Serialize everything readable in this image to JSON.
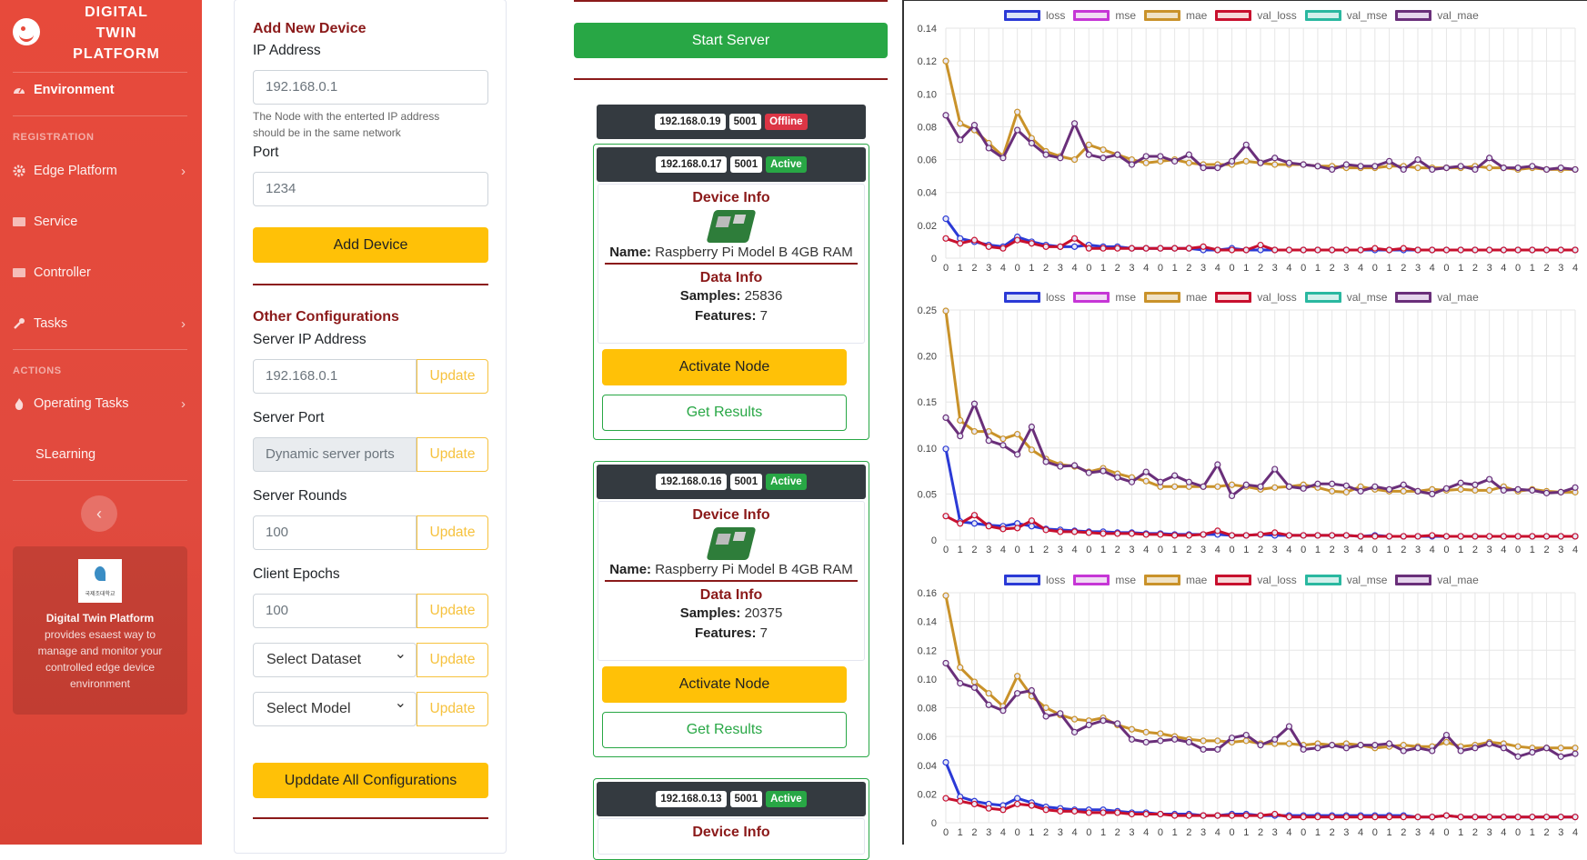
{
  "sidebar": {
    "brand": [
      "DIGITAL",
      "TWIN",
      "PLATFORM"
    ],
    "environment": "Environment",
    "registration_heading": "REGISTRATION",
    "edge_platform": "Edge Platform",
    "service": "Service",
    "controller": "Controller",
    "tasks": "Tasks",
    "actions_heading": "ACTIONS",
    "operating_tasks": "Operating Tasks",
    "slearning": "SLearning",
    "card_title": "Digital Twin Platform",
    "card_text": "provides esaest way to manage and monitor your controlled edge device environment",
    "logo_text": "국제조대학교"
  },
  "add_device": {
    "title": "Add New Device",
    "ip_label": "IP Address",
    "ip_placeholder": "192.168.0.1",
    "ip_help": "The Node with the enterted IP address should be in the same network",
    "port_label": "Port",
    "port_placeholder": "1234",
    "button": "Add Device"
  },
  "other_config": {
    "title": "Other Configurations",
    "server_ip_label": "Server IP Address",
    "server_ip_placeholder": "192.168.0.1",
    "server_port_label": "Server Port",
    "server_port_value": "Dynamic server ports",
    "server_rounds_label": "Server Rounds",
    "server_rounds_placeholder": "100",
    "client_epochs_label": "Client Epochs",
    "client_epochs_placeholder": "100",
    "dataset_select": "Select Dataset",
    "model_select": "Select Model",
    "update_label": "Update",
    "update_all": "Upddate All Configurations"
  },
  "server": {
    "start_button": "Start Server",
    "devices": [
      {
        "ip": "192.168.0.19",
        "port": "5001",
        "status": "Offline"
      },
      {
        "ip": "192.168.0.17",
        "port": "5001",
        "status": "Active",
        "device_info": "Device Info",
        "name_label": "Name:",
        "name": "Raspberry Pi Model B 4GB RAM",
        "data_info": "Data Info",
        "samples_label": "Samples:",
        "samples": "25836",
        "features_label": "Features:",
        "features": "7",
        "activate": "Activate Node",
        "results": "Get Results"
      },
      {
        "ip": "192.168.0.16",
        "port": "5001",
        "status": "Active",
        "device_info": "Device Info",
        "name_label": "Name:",
        "name": "Raspberry Pi Model B 4GB RAM",
        "data_info": "Data Info",
        "samples_label": "Samples:",
        "samples": "20375",
        "features_label": "Features:",
        "features": "7",
        "activate": "Activate Node",
        "results": "Get Results"
      },
      {
        "ip": "192.168.0.13",
        "port": "5001",
        "status": "Active",
        "device_info": "Device Info"
      }
    ]
  },
  "chart_data": [
    {
      "type": "line",
      "legend": [
        "loss",
        "mse",
        "mae",
        "val_loss",
        "val_mse",
        "val_mae"
      ],
      "x": [
        "0",
        "1",
        "2",
        "3",
        "4",
        "0",
        "1",
        "2",
        "3",
        "4",
        "0",
        "1",
        "2",
        "3",
        "4",
        "0",
        "1",
        "2",
        "3",
        "4",
        "0",
        "1",
        "2",
        "3",
        "4",
        "0",
        "1",
        "2",
        "3",
        "4",
        "0",
        "1",
        "2",
        "3",
        "4",
        "0",
        "1",
        "2",
        "3",
        "4",
        "0",
        "1",
        "2",
        "3",
        "4"
      ],
      "ylim": [
        0,
        0.14
      ],
      "yticks": [
        "0",
        "0.02",
        "0.04",
        "0.06",
        "0.08",
        "0.10",
        "0.12",
        "0.14"
      ],
      "series": [
        {
          "name": "loss",
          "values": [
            0.024,
            0.012,
            0.01,
            0.008,
            0.007,
            0.013,
            0.01,
            0.008,
            0.007,
            0.007,
            0.008,
            0.007,
            0.007,
            0.006,
            0.006,
            0.006,
            0.006,
            0.006,
            0.005,
            0.005,
            0.006,
            0.005,
            0.005,
            0.005,
            0.005,
            0.005,
            0.005,
            0.005,
            0.005,
            0.005,
            0.005,
            0.005,
            0.005,
            0.005,
            0.005,
            0.005,
            0.005,
            0.005,
            0.005,
            0.005,
            0.005,
            0.005,
            0.005,
            0.005,
            0.005
          ]
        },
        {
          "name": "val_loss",
          "values": [
            0.012,
            0.009,
            0.011,
            0.007,
            0.006,
            0.011,
            0.009,
            0.007,
            0.007,
            0.012,
            0.006,
            0.006,
            0.006,
            0.006,
            0.006,
            0.006,
            0.006,
            0.006,
            0.007,
            0.005,
            0.005,
            0.005,
            0.008,
            0.005,
            0.005,
            0.005,
            0.005,
            0.005,
            0.005,
            0.005,
            0.006,
            0.005,
            0.006,
            0.005,
            0.005,
            0.005,
            0.005,
            0.005,
            0.005,
            0.005,
            0.005,
            0.005,
            0.005,
            0.005,
            0.005
          ]
        },
        {
          "name": "mae",
          "values": [
            0.12,
            0.082,
            0.078,
            0.07,
            0.062,
            0.089,
            0.073,
            0.065,
            0.062,
            0.06,
            0.069,
            0.066,
            0.063,
            0.06,
            0.058,
            0.059,
            0.06,
            0.058,
            0.057,
            0.057,
            0.057,
            0.059,
            0.058,
            0.057,
            0.057,
            0.057,
            0.056,
            0.056,
            0.055,
            0.055,
            0.055,
            0.056,
            0.056,
            0.055,
            0.055,
            0.055,
            0.055,
            0.056,
            0.055,
            0.055,
            0.054,
            0.055,
            0.054,
            0.054,
            0.054
          ]
        },
        {
          "name": "val_mae",
          "values": [
            0.087,
            0.072,
            0.081,
            0.067,
            0.061,
            0.078,
            0.07,
            0.063,
            0.061,
            0.082,
            0.063,
            0.061,
            0.063,
            0.057,
            0.062,
            0.062,
            0.059,
            0.063,
            0.055,
            0.055,
            0.059,
            0.069,
            0.058,
            0.061,
            0.058,
            0.057,
            0.056,
            0.054,
            0.057,
            0.056,
            0.056,
            0.059,
            0.054,
            0.06,
            0.054,
            0.055,
            0.056,
            0.054,
            0.061,
            0.055,
            0.055,
            0.056,
            0.054,
            0.055,
            0.054
          ]
        }
      ]
    },
    {
      "type": "line",
      "legend": [
        "loss",
        "mse",
        "mae",
        "val_loss",
        "val_mse",
        "val_mae"
      ],
      "x": [
        "0",
        "1",
        "2",
        "3",
        "4",
        "0",
        "1",
        "2",
        "3",
        "4",
        "0",
        "1",
        "2",
        "3",
        "4",
        "0",
        "1",
        "2",
        "3",
        "4",
        "0",
        "1",
        "2",
        "3",
        "4",
        "0",
        "1",
        "2",
        "3",
        "4",
        "0",
        "1",
        "2",
        "3",
        "4",
        "0",
        "1",
        "2",
        "3",
        "4",
        "0",
        "1",
        "2",
        "3",
        "4"
      ],
      "ylim": [
        0,
        0.25
      ],
      "yticks": [
        "0",
        "0.05",
        "0.10",
        "0.15",
        "0.20",
        "0.25"
      ],
      "series": [
        {
          "name": "loss",
          "values": [
            0.099,
            0.02,
            0.018,
            0.016,
            0.015,
            0.018,
            0.015,
            0.012,
            0.011,
            0.01,
            0.009,
            0.009,
            0.008,
            0.008,
            0.007,
            0.007,
            0.006,
            0.006,
            0.006,
            0.006,
            0.005,
            0.005,
            0.006,
            0.005,
            0.005,
            0.005,
            0.005,
            0.005,
            0.005,
            0.004,
            0.005,
            0.004,
            0.004,
            0.004,
            0.004,
            0.004,
            0.004,
            0.004,
            0.004,
            0.004,
            0.004,
            0.004,
            0.004,
            0.004,
            0.004
          ]
        },
        {
          "name": "val_loss",
          "values": [
            0.026,
            0.018,
            0.027,
            0.015,
            0.012,
            0.013,
            0.021,
            0.011,
            0.009,
            0.009,
            0.008,
            0.007,
            0.007,
            0.007,
            0.006,
            0.006,
            0.005,
            0.005,
            0.006,
            0.01,
            0.005,
            0.005,
            0.006,
            0.008,
            0.005,
            0.005,
            0.005,
            0.005,
            0.005,
            0.004,
            0.004,
            0.004,
            0.004,
            0.004,
            0.005,
            0.004,
            0.004,
            0.004,
            0.004,
            0.004,
            0.004,
            0.004,
            0.004,
            0.004,
            0.004
          ]
        },
        {
          "name": "mae",
          "values": [
            0.249,
            0.13,
            0.118,
            0.118,
            0.11,
            0.115,
            0.098,
            0.088,
            0.082,
            0.08,
            0.074,
            0.078,
            0.072,
            0.068,
            0.064,
            0.058,
            0.058,
            0.058,
            0.058,
            0.058,
            0.06,
            0.058,
            0.055,
            0.057,
            0.058,
            0.06,
            0.057,
            0.053,
            0.052,
            0.058,
            0.055,
            0.053,
            0.053,
            0.053,
            0.055,
            0.054,
            0.055,
            0.054,
            0.054,
            0.058,
            0.053,
            0.055,
            0.053,
            0.052,
            0.052
          ]
        },
        {
          "name": "val_mae",
          "values": [
            0.133,
            0.113,
            0.148,
            0.108,
            0.103,
            0.093,
            0.123,
            0.085,
            0.08,
            0.081,
            0.073,
            0.075,
            0.068,
            0.063,
            0.074,
            0.063,
            0.07,
            0.063,
            0.058,
            0.082,
            0.048,
            0.06,
            0.058,
            0.077,
            0.058,
            0.056,
            0.061,
            0.061,
            0.059,
            0.053,
            0.058,
            0.055,
            0.06,
            0.053,
            0.05,
            0.056,
            0.062,
            0.06,
            0.066,
            0.054,
            0.055,
            0.054,
            0.051,
            0.052,
            0.057
          ]
        }
      ]
    },
    {
      "type": "line",
      "legend": [
        "loss",
        "mse",
        "mae",
        "val_loss",
        "val_mse",
        "val_mae"
      ],
      "x": [
        "0",
        "1",
        "2",
        "3",
        "4",
        "0",
        "1",
        "2",
        "3",
        "4",
        "0",
        "1",
        "2",
        "3",
        "4",
        "0",
        "1",
        "2",
        "3",
        "4",
        "0",
        "1",
        "2",
        "3",
        "4",
        "0",
        "1",
        "2",
        "3",
        "4",
        "0",
        "1",
        "2",
        "3",
        "4",
        "0",
        "1",
        "2",
        "3",
        "4",
        "0",
        "1",
        "2",
        "3",
        "4"
      ],
      "ylim": [
        0,
        0.16
      ],
      "yticks": [
        "0",
        "0.02",
        "0.04",
        "0.06",
        "0.08",
        "0.10",
        "0.12",
        "0.14",
        "0.16"
      ],
      "series": [
        {
          "name": "loss",
          "values": [
            0.042,
            0.018,
            0.015,
            0.013,
            0.012,
            0.017,
            0.014,
            0.011,
            0.01,
            0.009,
            0.009,
            0.009,
            0.008,
            0.007,
            0.007,
            0.006,
            0.006,
            0.006,
            0.005,
            0.005,
            0.006,
            0.006,
            0.005,
            0.005,
            0.005,
            0.005,
            0.005,
            0.005,
            0.005,
            0.005,
            0.005,
            0.005,
            0.005,
            0.004,
            0.004,
            0.005,
            0.004,
            0.004,
            0.004,
            0.004,
            0.004,
            0.004,
            0.004,
            0.004,
            0.004
          ]
        },
        {
          "name": "val_loss",
          "values": [
            0.017,
            0.015,
            0.013,
            0.01,
            0.009,
            0.013,
            0.012,
            0.009,
            0.008,
            0.008,
            0.007,
            0.007,
            0.007,
            0.006,
            0.006,
            0.006,
            0.005,
            0.005,
            0.005,
            0.005,
            0.005,
            0.005,
            0.005,
            0.006,
            0.004,
            0.004,
            0.004,
            0.004,
            0.004,
            0.004,
            0.004,
            0.004,
            0.004,
            0.004,
            0.004,
            0.005,
            0.004,
            0.004,
            0.004,
            0.004,
            0.004,
            0.004,
            0.004,
            0.004,
            0.004
          ]
        },
        {
          "name": "mae",
          "values": [
            0.158,
            0.108,
            0.098,
            0.09,
            0.081,
            0.102,
            0.088,
            0.08,
            0.075,
            0.072,
            0.071,
            0.073,
            0.068,
            0.065,
            0.063,
            0.062,
            0.06,
            0.058,
            0.057,
            0.057,
            0.056,
            0.057,
            0.055,
            0.055,
            0.055,
            0.054,
            0.055,
            0.054,
            0.055,
            0.054,
            0.052,
            0.053,
            0.054,
            0.053,
            0.053,
            0.056,
            0.053,
            0.054,
            0.056,
            0.055,
            0.053,
            0.052,
            0.052,
            0.052,
            0.052
          ]
        },
        {
          "name": "val_mae",
          "values": [
            0.111,
            0.097,
            0.094,
            0.082,
            0.078,
            0.09,
            0.092,
            0.074,
            0.076,
            0.063,
            0.068,
            0.071,
            0.069,
            0.058,
            0.056,
            0.057,
            0.058,
            0.056,
            0.051,
            0.051,
            0.059,
            0.061,
            0.054,
            0.058,
            0.067,
            0.051,
            0.052,
            0.054,
            0.052,
            0.054,
            0.054,
            0.055,
            0.05,
            0.052,
            0.05,
            0.061,
            0.05,
            0.052,
            0.055,
            0.052,
            0.046,
            0.049,
            0.052,
            0.046,
            0.048
          ]
        }
      ]
    }
  ],
  "colors": {
    "sidebar": "#e74a3b",
    "accent_dark_red": "#8b1a1a",
    "warning": "#ffc107",
    "success": "#28a745",
    "danger": "#dc3545",
    "loss": "#2b3ad6",
    "mse": "#c636d6",
    "mae": "#c9922a",
    "val_loss": "#c8102e",
    "val_mse": "#2ab8a0",
    "val_mae": "#6a2f7a"
  }
}
